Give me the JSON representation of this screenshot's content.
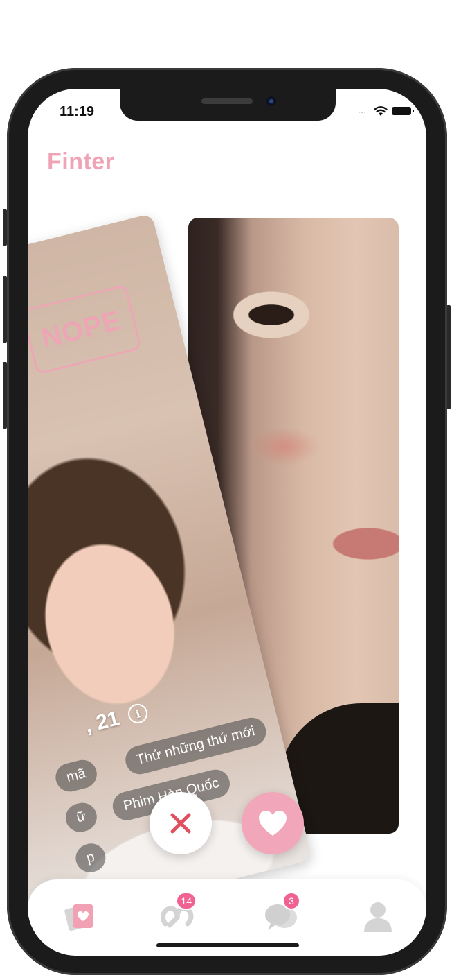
{
  "status_bar": {
    "time": "11:19",
    "signal_dots": "....",
    "wifi_icon": "wifi-icon",
    "battery_icon": "battery-icon"
  },
  "app": {
    "name": "Finter",
    "brand_color": "#f0a3b6"
  },
  "card": {
    "stamp": "NOPE",
    "name_age": ", 21",
    "info_icon": "info-icon",
    "interests": [
      "mã",
      "Thử những thứ mới",
      "ữ",
      "Phim Hàn Quốc",
      "p"
    ]
  },
  "actions": {
    "nope_icon": "close-icon",
    "like_icon": "heart-icon",
    "nope_color": "#e0505e",
    "like_color": "#f2a6b9"
  },
  "tabbar": {
    "tabs": [
      {
        "id": "discover",
        "icon": "cards-icon",
        "badge": ""
      },
      {
        "id": "matches",
        "icon": "matches-icon",
        "badge": "14"
      },
      {
        "id": "messages",
        "icon": "chat-icon",
        "badge": "3"
      },
      {
        "id": "profile",
        "icon": "profile-icon",
        "badge": ""
      }
    ]
  }
}
